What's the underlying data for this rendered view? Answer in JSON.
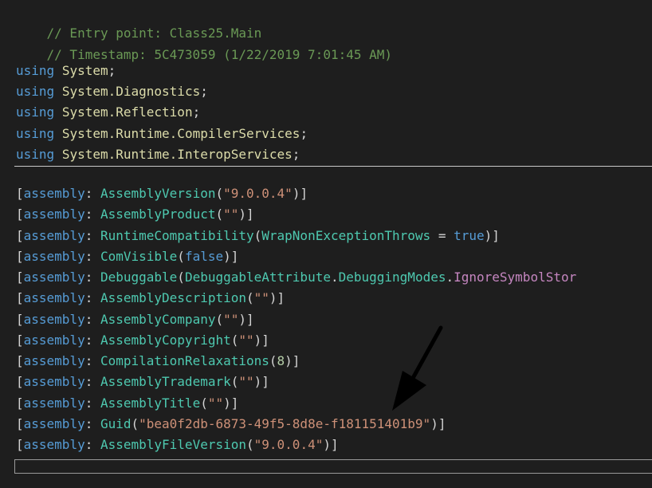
{
  "header_comments": [
    "// Entry point: Class25.Main",
    "// Timestamp: 5C473059 (1/22/2019 7:01:45 AM)"
  ],
  "using_keyword": "using",
  "usings": [
    "System",
    "System.Diagnostics",
    "System.Reflection",
    "System.Runtime.CompilerServices",
    "System.Runtime.InteropServices"
  ],
  "assembly_keyword": "assembly",
  "attributes": {
    "version": {
      "name": "AssemblyVersion",
      "value": "\"9.0.0.4\""
    },
    "product": {
      "name": "AssemblyProduct",
      "value": "\"\""
    },
    "runtime_compat": {
      "name": "RuntimeCompatibility",
      "param": "WrapNonExceptionThrows",
      "op": " = ",
      "value": "true"
    },
    "com_visible": {
      "name": "ComVisible",
      "value": "false"
    },
    "debuggable": {
      "name": "Debuggable",
      "type": "DebuggableAttribute",
      "member": "DebuggingModes",
      "enum": "IgnoreSymbolStor"
    },
    "description": {
      "name": "AssemblyDescription",
      "value": "\"\""
    },
    "company": {
      "name": "AssemblyCompany",
      "value": "\"\""
    },
    "copyright": {
      "name": "AssemblyCopyright",
      "value": "\"\""
    },
    "compilation": {
      "name": "CompilationRelaxations",
      "value": "8"
    },
    "trademark": {
      "name": "AssemblyTrademark",
      "value": "\"\""
    },
    "title": {
      "name": "AssemblyTitle",
      "value": "\"\""
    },
    "guid": {
      "name": "Guid",
      "value": "\"bea0f2db-6873-49f5-8d8e-f181151401b9\""
    },
    "file_version": {
      "name": "AssemblyFileVersion",
      "value": "\"9.0.0.4\""
    }
  },
  "colors": {
    "background": "#1e1e1e",
    "comment": "#6a9955",
    "keyword": "#569cd6",
    "namespace": "#dcdcaa",
    "type": "#4ec9b0",
    "string": "#ce9178",
    "parameter": "#9cdcfe",
    "enum_member": "#c586c0"
  },
  "annotation": {
    "icon": "arrow-pointer-icon",
    "color": "#000000"
  }
}
